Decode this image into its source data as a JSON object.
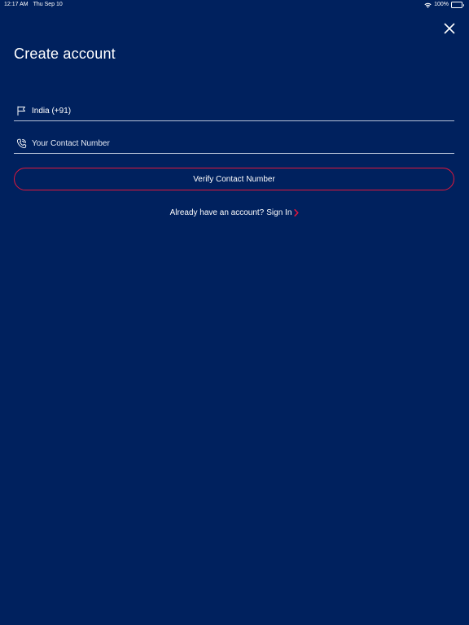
{
  "status_bar": {
    "time": "12:17 AM",
    "date": "Thu Sep 10",
    "battery": "100%",
    "battery_level": 1.0
  },
  "header": {
    "title": "Create account",
    "close_icon": "close-icon"
  },
  "form": {
    "country": {
      "icon": "flag-icon",
      "value": "India (+91)"
    },
    "phone": {
      "icon": "phone-icon",
      "placeholder": "Your Contact Number",
      "value": ""
    },
    "verify_label": "Verify Contact Number"
  },
  "signin": {
    "question": "Already have an account?",
    "link_label": "Sign In",
    "chevron_icon": "chevron-right-icon"
  },
  "colors": {
    "background": "#00215e",
    "accent": "#e0173c",
    "text": "#ffffff",
    "divider": "#b7c2d8"
  }
}
